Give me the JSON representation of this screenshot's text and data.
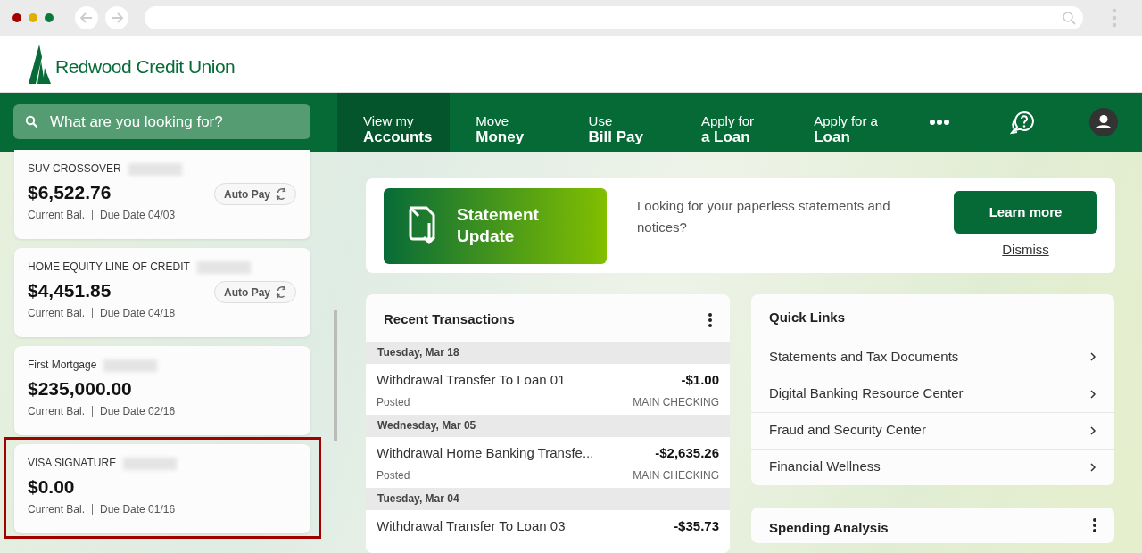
{
  "brand": {
    "name": "Redwood Credit Union"
  },
  "search": {
    "placeholder": "What are you looking for?"
  },
  "nav": [
    {
      "line1": "View my",
      "line2": "Accounts",
      "selected": true
    },
    {
      "line1": "Move",
      "line2": "Money",
      "selected": false
    },
    {
      "line1": "Use",
      "line2": "Bill Pay",
      "selected": false
    },
    {
      "line1": "Apply for",
      "line2": "a Loan",
      "selected": false
    },
    {
      "line1": "Apply for a",
      "line2": "Loan",
      "selected": false
    }
  ],
  "accounts": [
    {
      "name": "SUV CROSSOVER",
      "balance": "$6,522.76",
      "balance_label": "Current Bal.",
      "due": "Due Date 04/03",
      "autopay": "Auto Pay"
    },
    {
      "name": "HOME EQUITY LINE OF CREDIT",
      "balance": "$4,451.85",
      "balance_label": "Current Bal.",
      "due": "Due Date 04/18",
      "autopay": "Auto Pay"
    },
    {
      "name": "First Mortgage",
      "balance": "$235,000.00",
      "balance_label": "Current Bal.",
      "due": "Due Date 02/16"
    },
    {
      "name": "VISA SIGNATURE",
      "balance": "$0.00",
      "balance_label": "Current Bal.",
      "due": "Due Date 01/16",
      "highlighted": true
    }
  ],
  "banner": {
    "title": "Statement Update",
    "text": "Looking for your paperless statements and notices?",
    "button": "Learn more",
    "dismiss": "Dismiss"
  },
  "transactions": {
    "title": "Recent Transactions",
    "groups": [
      {
        "date": "Tuesday, Mar 18",
        "items": [
          {
            "description": "Withdrawal Transfer To Loan 01",
            "amount": "-$1.00",
            "status": "Posted",
            "account": "MAIN CHECKING"
          }
        ]
      },
      {
        "date": "Wednesday, Mar 05",
        "items": [
          {
            "description": "Withdrawal Home Banking Transfe...",
            "amount": "-$2,635.26",
            "status": "Posted",
            "account": "MAIN CHECKING"
          }
        ]
      },
      {
        "date": "Tuesday, Mar 04",
        "items": [
          {
            "description": "Withdrawal Transfer To Loan 03",
            "amount": "-$35.73"
          }
        ]
      }
    ]
  },
  "quick_links": {
    "title": "Quick Links",
    "items": [
      "Statements and Tax Documents",
      "Digital Banking Resource Center",
      "Fraud and Security Center",
      "Financial Wellness"
    ]
  },
  "spending": {
    "title": "Spending Analysis"
  }
}
